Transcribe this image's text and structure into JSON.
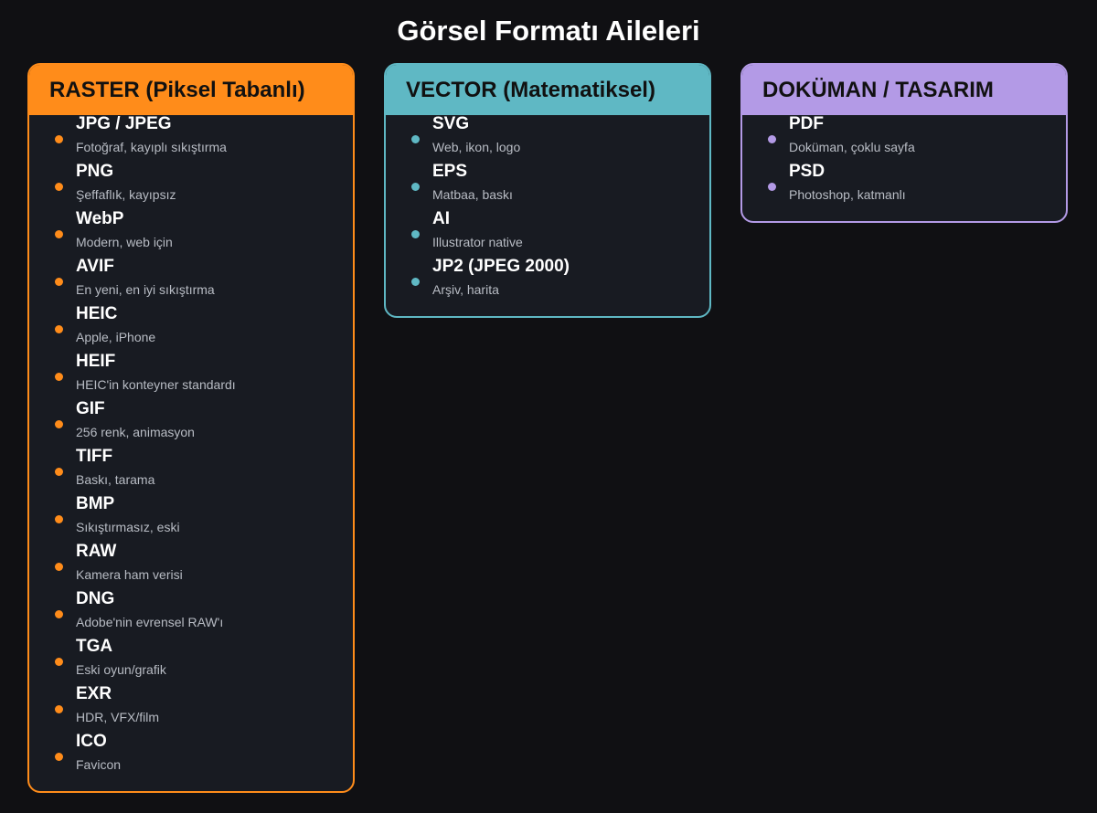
{
  "title": "Görsel Formatı Aileleri",
  "families": [
    {
      "id": "raster",
      "label": "RASTER (Piksel Tabanlı)",
      "color": "#ff8c1a",
      "items": [
        {
          "name": "JPG / JPEG",
          "desc": "Fotoğraf, kayıplı sıkıştırma"
        },
        {
          "name": "PNG",
          "desc": "Şeffaflık, kayıpsız"
        },
        {
          "name": "WebP",
          "desc": "Modern, web için"
        },
        {
          "name": "AVIF",
          "desc": "En yeni, en iyi sıkıştırma"
        },
        {
          "name": "HEIC",
          "desc": "Apple, iPhone"
        },
        {
          "name": "HEIF",
          "desc": "HEIC'in konteyner standardı"
        },
        {
          "name": "GIF",
          "desc": "256 renk, animasyon"
        },
        {
          "name": "TIFF",
          "desc": "Baskı, tarama"
        },
        {
          "name": "BMP",
          "desc": "Sıkıştırmasız, eski"
        },
        {
          "name": "RAW",
          "desc": "Kamera ham verisi"
        },
        {
          "name": "DNG",
          "desc": "Adobe'nin evrensel RAW'ı"
        },
        {
          "name": "TGA",
          "desc": "Eski oyun/grafik"
        },
        {
          "name": "EXR",
          "desc": "HDR, VFX/film"
        },
        {
          "name": "ICO",
          "desc": "Favicon"
        }
      ]
    },
    {
      "id": "vector",
      "label": "VECTOR (Matematiksel)",
      "color": "#5fb8c4",
      "items": [
        {
          "name": "SVG",
          "desc": "Web, ikon, logo"
        },
        {
          "name": "EPS",
          "desc": "Matbaa, baskı"
        },
        {
          "name": "AI",
          "desc": "Illustrator native"
        },
        {
          "name": "JP2 (JPEG 2000)",
          "desc": "Arşiv, harita"
        }
      ]
    },
    {
      "id": "document",
      "label": "DOKÜMAN / TASARIM",
      "color": "#b39ae6",
      "items": [
        {
          "name": "PDF",
          "desc": "Doküman, çoklu sayfa"
        },
        {
          "name": "PSD",
          "desc": "Photoshop, katmanlı"
        }
      ]
    }
  ]
}
